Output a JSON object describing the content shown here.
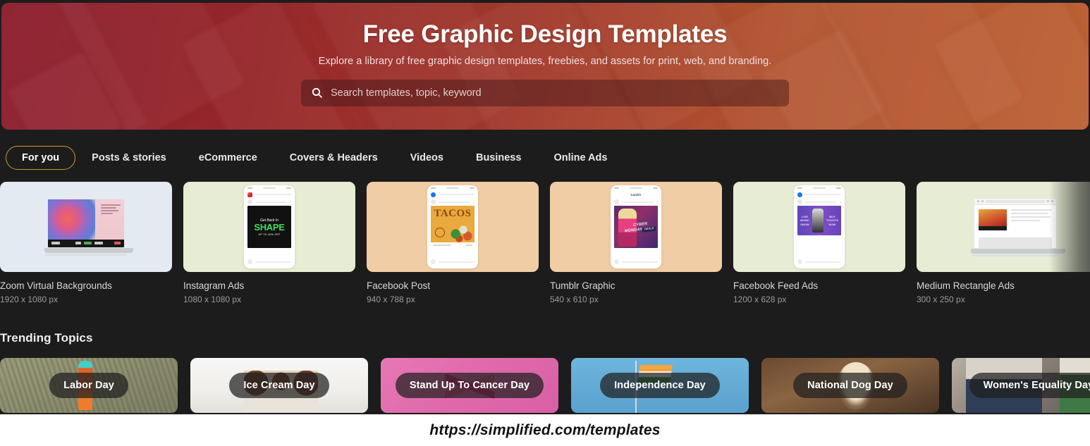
{
  "hero": {
    "title": "Free Graphic Design Templates",
    "subtitle": "Explore a library of free graphic design templates, freebies, and assets for print, web, and branding.",
    "search_placeholder": "Search templates, topic, keyword",
    "search_value": "",
    "gradient_from": "#8e2135",
    "gradient_to": "#c2703f"
  },
  "tabs": {
    "active_index": 0,
    "accent_color": "#c79b2e",
    "items": [
      {
        "label": "For you"
      },
      {
        "label": "Posts & stories"
      },
      {
        "label": "eCommerce"
      },
      {
        "label": "Covers & Headers"
      },
      {
        "label": "Videos"
      },
      {
        "label": "Business"
      },
      {
        "label": "Online Ads"
      }
    ]
  },
  "templates": {
    "next_icon": "chevron-right-icon",
    "cards": [
      {
        "title": "Zoom Virtual Backgrounds",
        "dims": "1920 x 1080 px",
        "bg": "#e3eaf1",
        "device": "laptop"
      },
      {
        "title": "Instagram Ads",
        "dims": "1080 x 1080 px",
        "bg": "#e6edd4",
        "device": "phone-ig"
      },
      {
        "title": "Facebook Post",
        "dims": "940 x 788 px",
        "bg": "#f0cda4",
        "device": "phone-fb"
      },
      {
        "title": "Tumblr Graphic",
        "dims": "540 x 610 px",
        "bg": "#f0cda4",
        "device": "phone-tumblr"
      },
      {
        "title": "Facebook Feed Ads",
        "dims": "1200 x 628 px",
        "bg": "#e6edd4",
        "device": "phone-fbad"
      },
      {
        "title": "Medium Rectangle Ads",
        "dims": "300 x 250 px",
        "bg": "#e6edd4",
        "device": "browser"
      }
    ]
  },
  "trending": {
    "heading": "Trending Topics",
    "next_icon": "chevron-right-icon",
    "topics": [
      {
        "label": "Labor Day",
        "theme": "bg-labor"
      },
      {
        "label": "Ice Cream Day",
        "theme": "bg-icecream"
      },
      {
        "label": "Stand Up To Cancer Day",
        "theme": "bg-cancer"
      },
      {
        "label": "Independence Day",
        "theme": "bg-independence"
      },
      {
        "label": "National Dog Day",
        "theme": "bg-dog"
      },
      {
        "label": "Women's Equality Day",
        "theme": "bg-women"
      }
    ]
  },
  "footer": {
    "url": "https://simplified.com/templates"
  }
}
